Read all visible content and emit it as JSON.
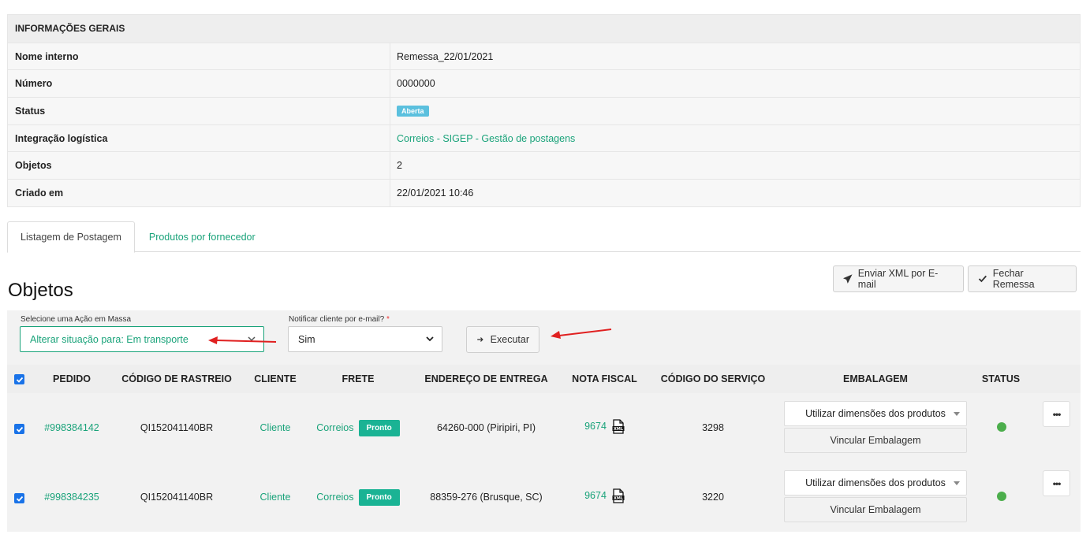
{
  "info": {
    "header": "INFORMAÇÕES GERAIS",
    "rows": [
      {
        "label": "Nome interno",
        "value": "Remessa_22/01/2021"
      },
      {
        "label": "Número",
        "value": "0000000"
      },
      {
        "label": "Status",
        "value": "Aberta"
      },
      {
        "label": "Integração logística",
        "value": "Correios - SIGEP - Gestão de postagens"
      },
      {
        "label": "Objetos",
        "value": "2"
      },
      {
        "label": "Criado em",
        "value": "22/01/2021 10:46"
      }
    ],
    "status_color": "#5bc0de",
    "link_color": "#1aa37a"
  },
  "tabs": [
    {
      "label": "Listagem de Postagem",
      "active": true
    },
    {
      "label": "Produtos por fornecedor",
      "active": false
    }
  ],
  "heading": "Objetos",
  "actions": {
    "send_xml": "Enviar XML por E-mail",
    "close_shipment": "Fechar Remessa"
  },
  "mass": {
    "action_label": "Selecione uma Ação em Massa",
    "action_value": "Alterar situação para: Em transporte",
    "notify_label": "Notificar cliente por e-mail?",
    "notify_required": "*",
    "notify_value": "Sim",
    "execute": "Executar"
  },
  "table": {
    "headers": [
      "PEDIDO",
      "CÓDIGO DE RASTREIO",
      "CLIENTE",
      "FRETE",
      "ENDEREÇO DE ENTREGA",
      "NOTA FISCAL",
      "CÓDIGO DO SERVIÇO",
      "EMBALAGEM",
      "STATUS"
    ],
    "rows": [
      {
        "checked": true,
        "order": "#998384142",
        "tracking": "QI152041140BR",
        "client": "Cliente",
        "carrier": "Correios",
        "carrier_badge": "Pronto",
        "address": "64260-000 (Piripiri, PI)",
        "invoice": "9674",
        "service": "3298",
        "packaging_select": "Utilizar dimensões dos produtos",
        "packaging_button": "Vincular Embalagem",
        "status_color": "#4cae4c",
        "more": "•••"
      },
      {
        "checked": true,
        "order": "#998384235",
        "tracking": "QI152041140BR",
        "client": "Cliente",
        "carrier": "Correios",
        "carrier_badge": "Pronto",
        "address": "88359-276 (Brusque, SC)",
        "invoice": "9674",
        "service": "3220",
        "packaging_select": "Utilizar dimensões dos produtos",
        "packaging_button": "Vincular Embalagem",
        "status_color": "#4cae4c",
        "more": "•••"
      }
    ]
  },
  "accent_color": "#1aa37a",
  "annotation_arrow_color": "#e02020"
}
